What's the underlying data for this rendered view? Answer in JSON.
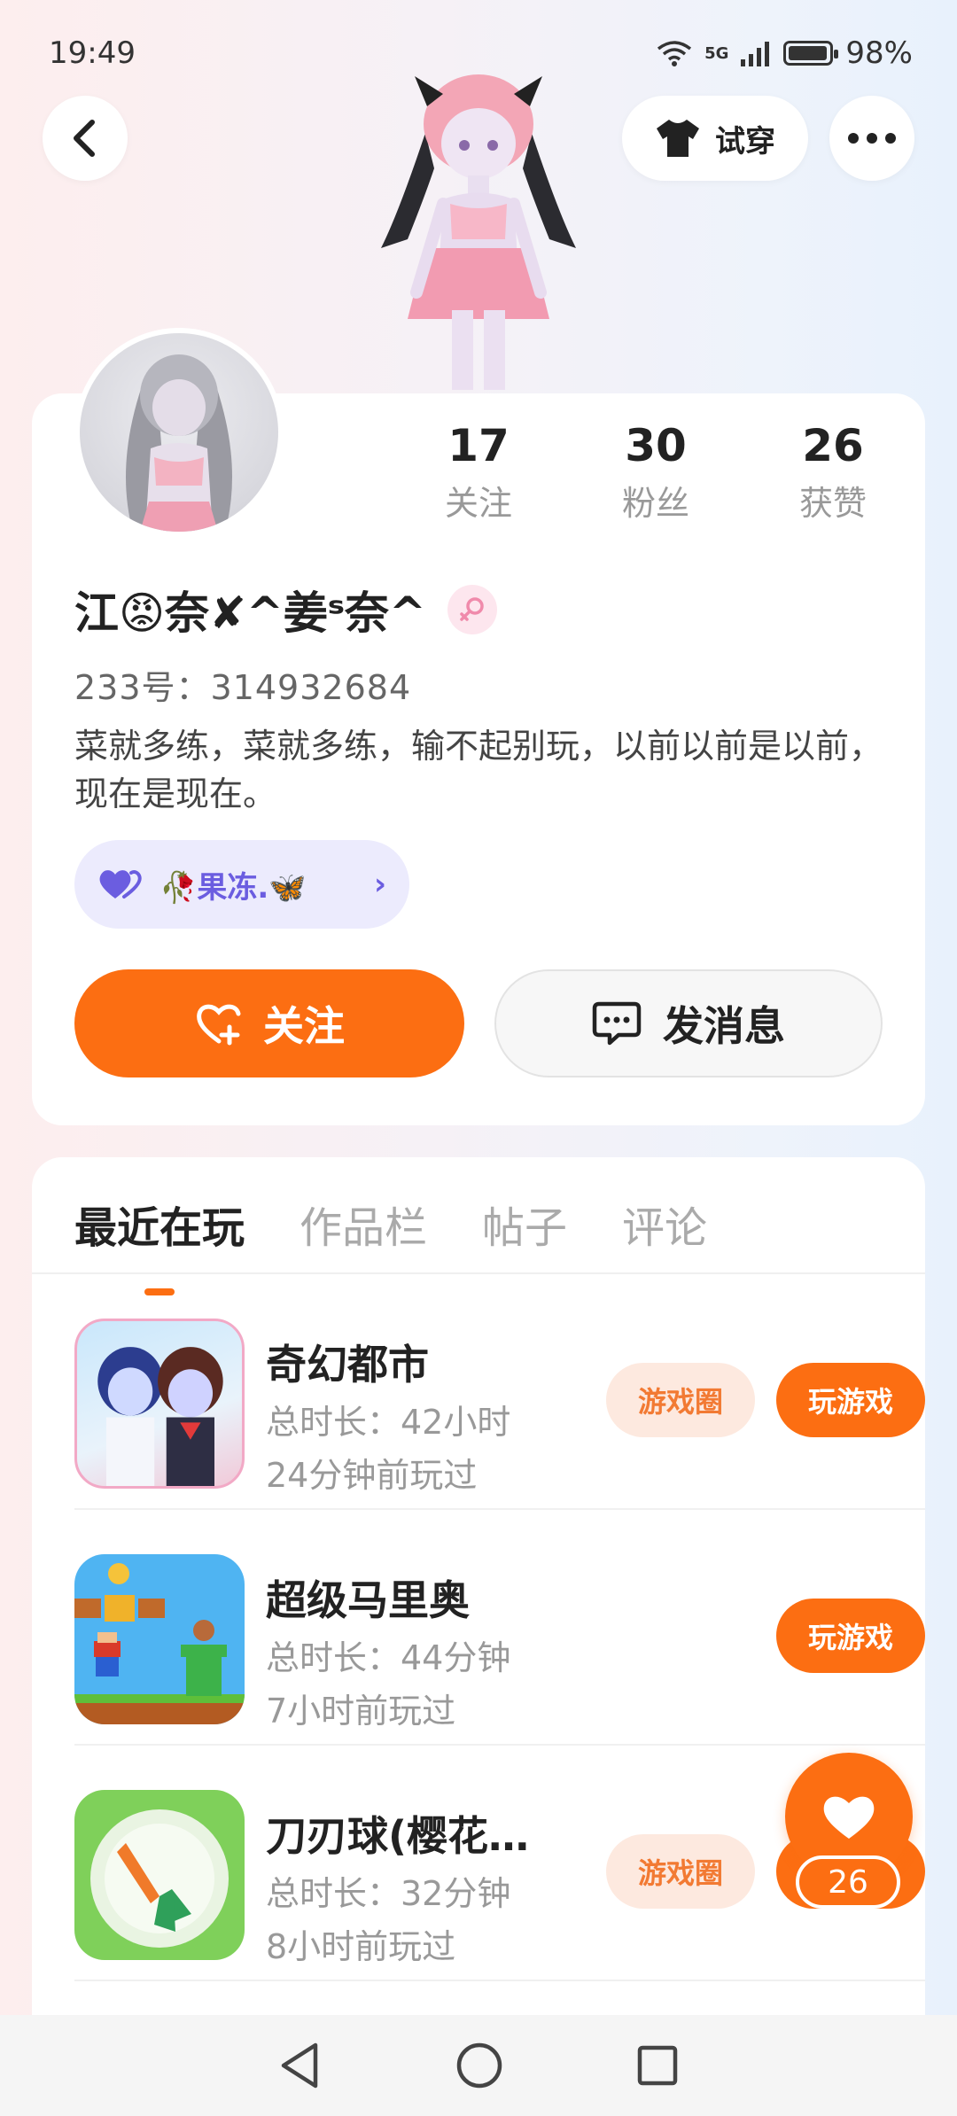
{
  "status_bar": {
    "time": "19:49",
    "network": "5G",
    "battery": "98%"
  },
  "header": {
    "tryon_label": "试穿"
  },
  "profile": {
    "stats": [
      {
        "value": "17",
        "label": "关注"
      },
      {
        "value": "30",
        "label": "粉丝"
      },
      {
        "value": "26",
        "label": "获赞"
      }
    ],
    "nickname": "江😡奈✘^姜ˢ奈^",
    "uid": "233号：314932684",
    "bio": "菜就多练，菜就多练，输不起别玩，以前以前是以前，现在是现在。",
    "club": "🥀果冻.🦋",
    "follow_label": "关注",
    "message_label": "发消息"
  },
  "tabs": [
    "最近在玩",
    "作品栏",
    "帖子",
    "评论"
  ],
  "games": [
    {
      "name": "奇幻都市",
      "duration": "总时长：42小时",
      "last_played": "24分钟前玩过",
      "circle_label": "游戏圈",
      "play_label": "玩游戏"
    },
    {
      "name": "超级马里奥",
      "duration": "总时长：44分钟",
      "last_played": "7小时前玩过",
      "circle_label": "",
      "play_label": "玩游戏"
    },
    {
      "name": "刀刃球(樱花…",
      "duration": "总时长：32分钟",
      "last_played": "8小时前玩过",
      "circle_label": "游戏圈",
      "play_label": "玩游戏"
    }
  ],
  "like_fab": {
    "count": "26"
  },
  "colors": {
    "accent": "#fc6e12",
    "club_bg": "#ecebfd",
    "club_text": "#6b5de0"
  }
}
